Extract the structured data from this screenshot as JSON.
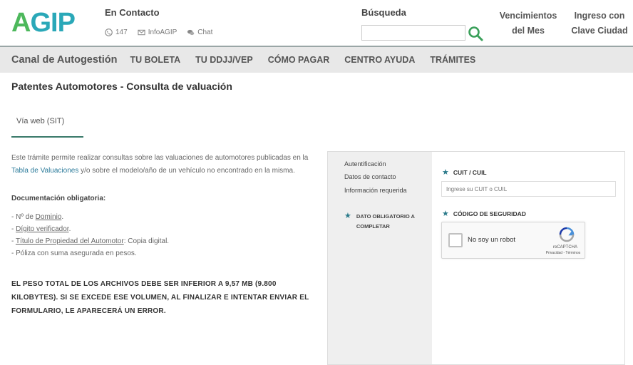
{
  "header": {
    "logo_first": "A",
    "logo_rest": "GIP",
    "contact_title": "En Contacto",
    "contact_phone": "147",
    "contact_email": "InfoAGIP",
    "contact_chat": "Chat",
    "search_label": "Búsqueda",
    "search_value": "",
    "vencimientos_line1": "Vencimientos",
    "vencimientos_line2": "del Mes",
    "ingreso_line1": "Ingreso con",
    "ingreso_line2": "Clave Ciudad"
  },
  "nav": {
    "brand": "Canal de Autogestión",
    "items": [
      "TU BOLETA",
      "TU DDJJ/VEP",
      "CÓMO PAGAR",
      "CENTRO AYUDA",
      "TRÁMITES"
    ]
  },
  "page": {
    "title": "Patentes Automotores - Consulta de valuación",
    "tab": "Vía web (SIT)"
  },
  "content": {
    "intro_part1": "Este trámite permite realizar consultas sobre las valuaciones de automotores publicadas en la ",
    "intro_link": "Tabla de Valuaciones",
    "intro_part2": " y/o sobre el modelo/año de un vehículo no encontrado en la misma.",
    "doc_title": "Documentación obligatoria:",
    "doc_items": [
      {
        "prefix": "- Nº de ",
        "link": "Dominio",
        "suffix": "."
      },
      {
        "prefix": "- ",
        "link": "Dígito verificador",
        "suffix": "."
      },
      {
        "prefix": "- ",
        "link": "Título de Propiedad del Automotor",
        "suffix": ": Copia digital."
      },
      {
        "prefix": "- Póliza con suma asegurada en pesos.",
        "link": "",
        "suffix": ""
      }
    ],
    "warning": "EL PESO TOTAL DE LOS ARCHIVOS DEBE SER INFERIOR A 9,57 MB (9.800 KILOBYTES). SI SE EXCEDE ESE VOLUMEN, AL FINALIZAR E INTENTAR ENVIAR EL FORMULARIO, LE APARECERÁ UN ERROR."
  },
  "panel": {
    "steps": [
      "Autentificación",
      "Datos de contacto",
      "Información requerida"
    ],
    "required_note_line1": "DATO OBLIGATORIO A",
    "required_note_line2": "COMPLETAR",
    "cuit_label": "CUIT / CUIL",
    "cuit_placeholder": "Ingrese su CUIT o CUIL",
    "security_label": "CÓDIGO DE SEGURIDAD",
    "captcha_label": "No soy un robot",
    "captcha_brand": "reCAPTCHA",
    "captcha_terms": "Privacidad - Términos"
  },
  "colors": {
    "accent": "#3a7a6a",
    "logo_green": "#4db85c",
    "logo_teal": "#2aa8b8",
    "nav_bg": "#e8e8e8",
    "link": "#2a7a9a"
  }
}
